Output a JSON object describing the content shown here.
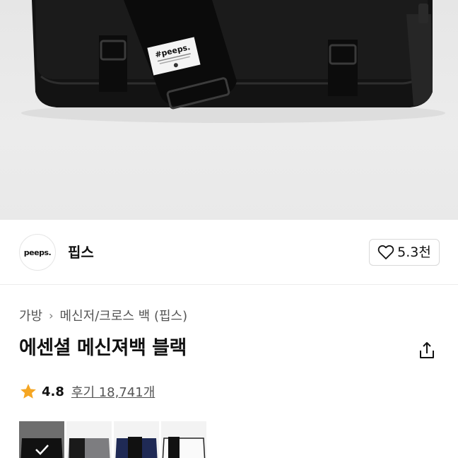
{
  "product_image": {
    "label_text": "#peeps."
  },
  "brand": {
    "logo_text": "peeps.",
    "name": "핍스",
    "like_count": "5.3천"
  },
  "breadcrumb": [
    "가방",
    "메신저/크로스 백 (핍스)"
  ],
  "product": {
    "title": "에센셜 메신져백 블랙"
  },
  "rating": {
    "score": "4.8",
    "reviews": "후기 18,741개"
  },
  "colors": {
    "star": "#F5A623",
    "divider": "#ECECEC"
  },
  "swatches": [
    {
      "name": "black",
      "color": "#111111",
      "selected": true
    },
    {
      "name": "gray",
      "color": "#7d7d80",
      "selected": false
    },
    {
      "name": "navy",
      "color": "#1f2a55",
      "selected": false
    },
    {
      "name": "white",
      "color": "#f4f4f4",
      "selected": false
    }
  ]
}
